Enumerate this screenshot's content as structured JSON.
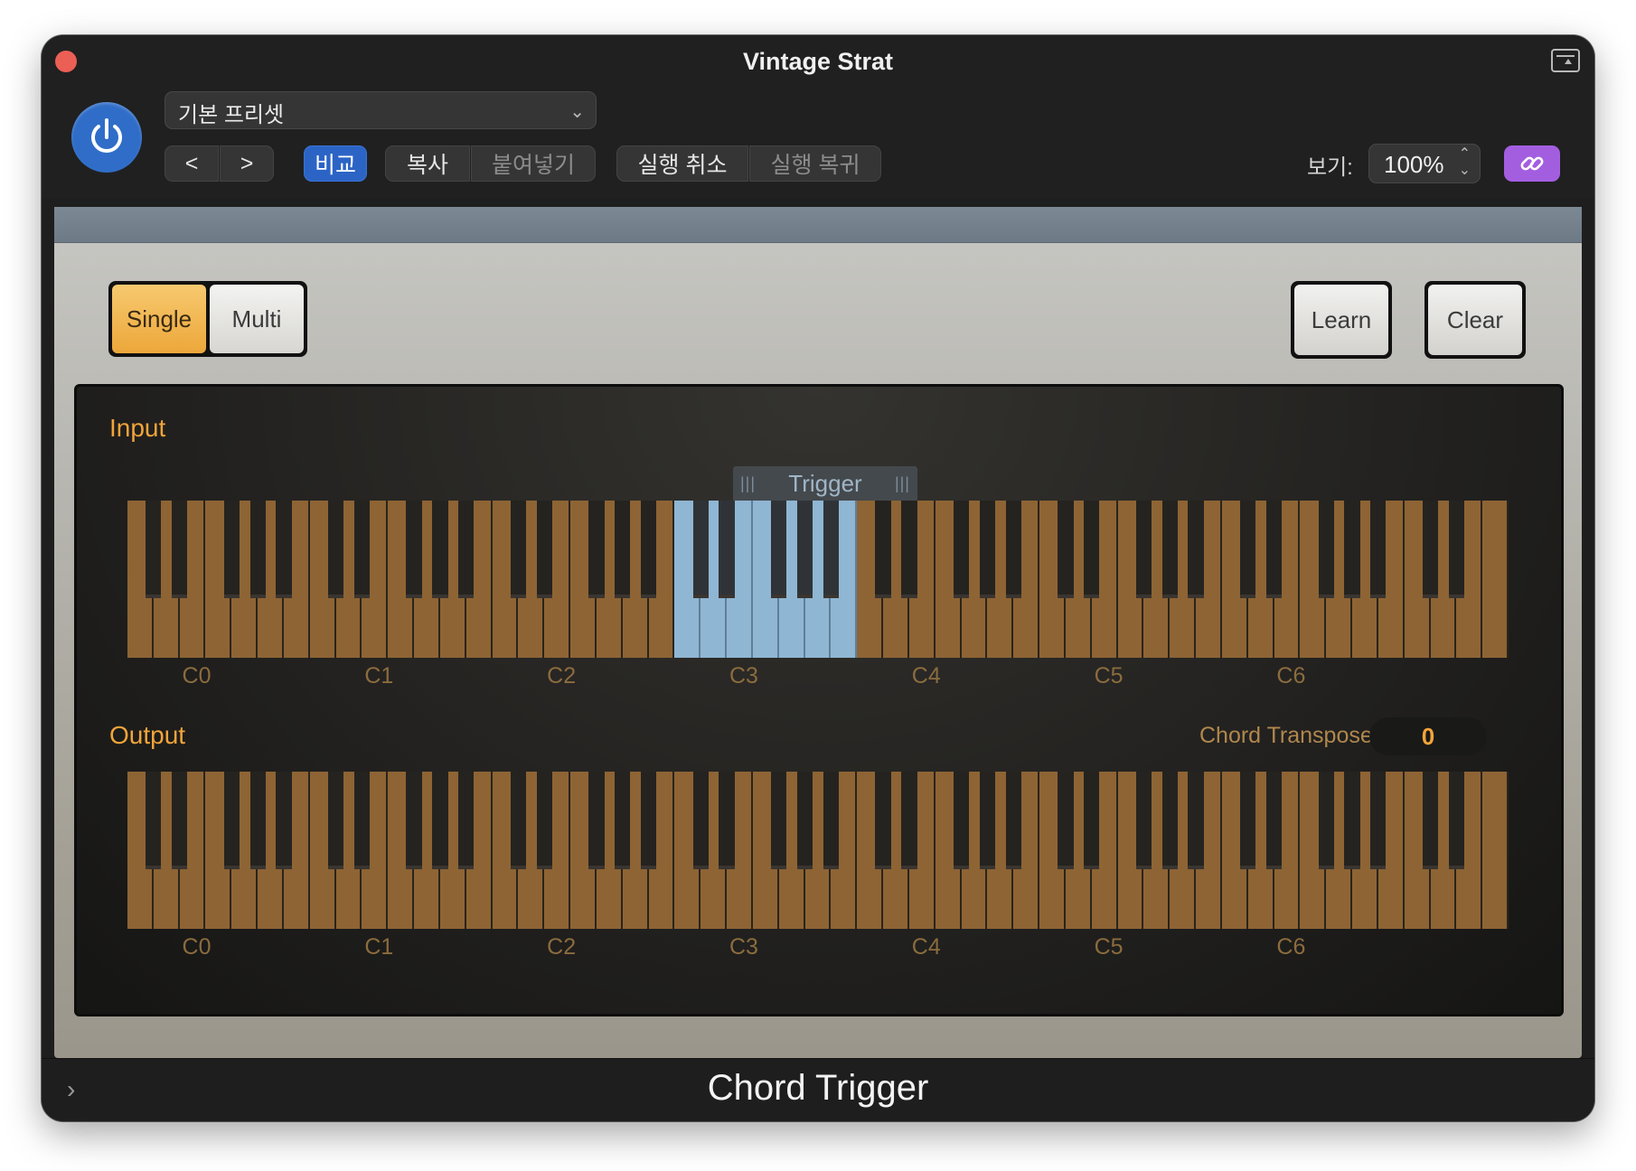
{
  "window": {
    "title": "Vintage Strat"
  },
  "toolbar": {
    "preset": "기본 프리셋",
    "prev_label": "<",
    "next_label": ">",
    "compare": "비교",
    "copy": "복사",
    "paste": "붙여넣기",
    "undo": "실행 취소",
    "redo": "실행 복귀",
    "zoom_label": "보기:",
    "zoom_value": "100%",
    "icons": [
      "power-icon",
      "chevron-down-icon",
      "link-icon",
      "expand-icon"
    ]
  },
  "plugin": {
    "mode": {
      "single": "Single",
      "multi": "Multi",
      "selected": "Single"
    },
    "learn": "Learn",
    "clear": "Clear",
    "input_label": "Input",
    "output_label": "Output",
    "trigger_label": "Trigger",
    "octaves": [
      "C0",
      "C1",
      "C2",
      "C3",
      "C4",
      "C5",
      "C6"
    ],
    "chord_transpose_label": "Chord Transpose",
    "chord_transpose_value": "0",
    "trigger_range": {
      "from": "C3",
      "to": "B3"
    },
    "colors": {
      "accent": "#f2a43a",
      "key": "#8e6434",
      "highlight": "#8fb6d3"
    }
  },
  "footer": {
    "plugin_name": "Chord Trigger"
  }
}
